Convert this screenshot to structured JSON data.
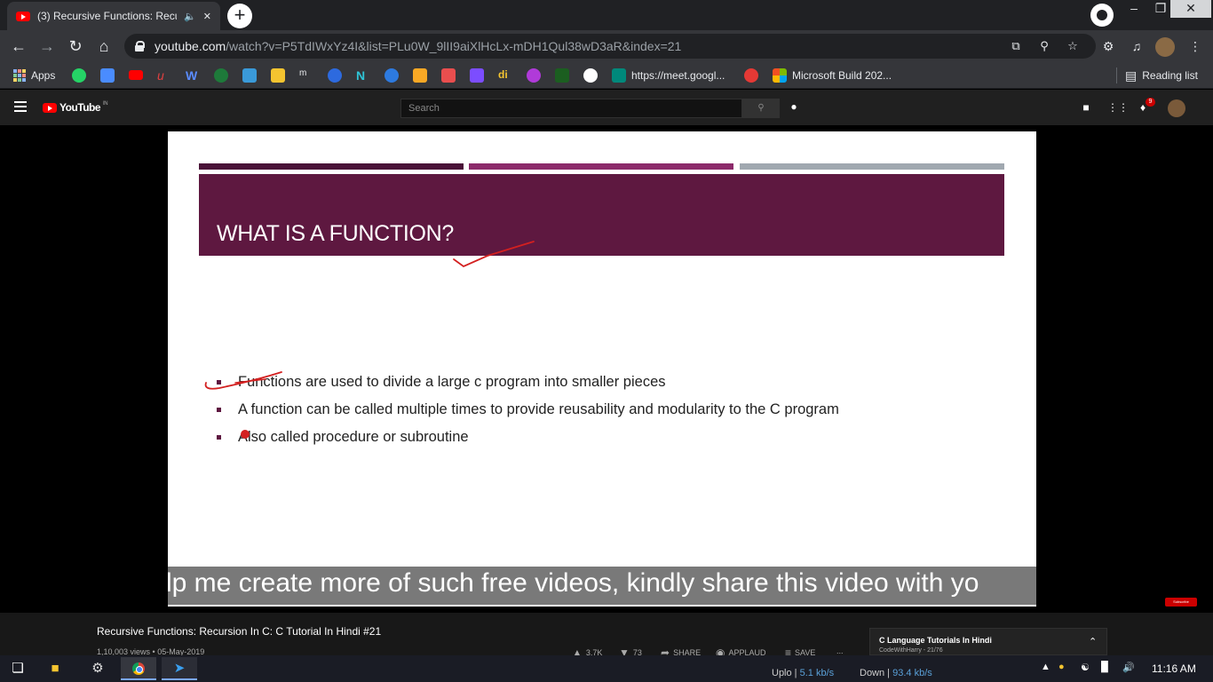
{
  "browser": {
    "tab_title": "(3) Recursive Functions: Recu",
    "newtab_label": "+",
    "url_host": "youtube.com",
    "url_path": "/watch?v=P5TdIWxYz4I&list=PLu0W_9lII9aiXlHcLx-mDH1Qul38wD3aR&index=21",
    "bookmarks": {
      "apps_label": "Apps",
      "meet_label": "https://meet.googl...",
      "build_label": "Microsoft Build 202...",
      "reading_list_label": "Reading list"
    }
  },
  "youtube": {
    "logo_text": "YouTube",
    "country_code": "IN",
    "search_placeholder": "Search",
    "notification_count": "9",
    "video_title": "Recursive Functions: Recursion In C: C Tutorial In Hindi #21",
    "video_meta": "1,10,003 views • 05-May-2019",
    "actions": {
      "likes": "3.7K",
      "dislikes": "73",
      "share": "SHARE",
      "applaud": "APPLAUD",
      "save": "SAVE",
      "more": "..."
    },
    "playlist": {
      "title": "C Language Tutorials In Hindi",
      "subtitle": "CodeWithHarry - 21/76"
    },
    "subscribe_badge": "Subscribe"
  },
  "slide": {
    "title": "WHAT IS A FUNCTION?",
    "bullets": [
      "Functions are used to divide a large c program into smaller pieces",
      "A function can be called multiple times to provide reusability and modularity to the C program",
      "Also called procedure or subroutine"
    ],
    "caption": "lp me create more of such free videos, kindly share this video with yo",
    "colors": {
      "band": "#5e1840",
      "stripe1": "#4a1238",
      "stripe2": "#8c2a6a",
      "stripe3": "#a0a8b0",
      "annotation": "#d32020"
    }
  },
  "taskbar": {
    "upload_label": "Uplo",
    "upload_value": "5.1 kb/s",
    "download_label": "Down",
    "download_value": "93.4 kb/s",
    "time": "11:16 AM"
  }
}
